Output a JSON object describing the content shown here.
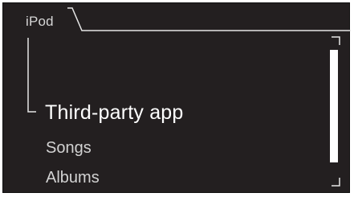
{
  "header": {
    "tab_label": "iPod",
    "tab_icon": "ipod-source-tab"
  },
  "menu": {
    "items": [
      {
        "label": "Third-party app",
        "selected": true
      },
      {
        "label": "Songs",
        "selected": false
      },
      {
        "label": "Albums",
        "selected": false
      }
    ]
  },
  "scroll": {
    "visible_fraction": 0.72,
    "position_fraction": 0.0
  },
  "colors": {
    "screen_background": "#231f20",
    "line": "#e6e6e6",
    "selected_text": "#ffffff",
    "menu_text": "#d2d2d2",
    "scroll_thumb": "#ffffff"
  }
}
